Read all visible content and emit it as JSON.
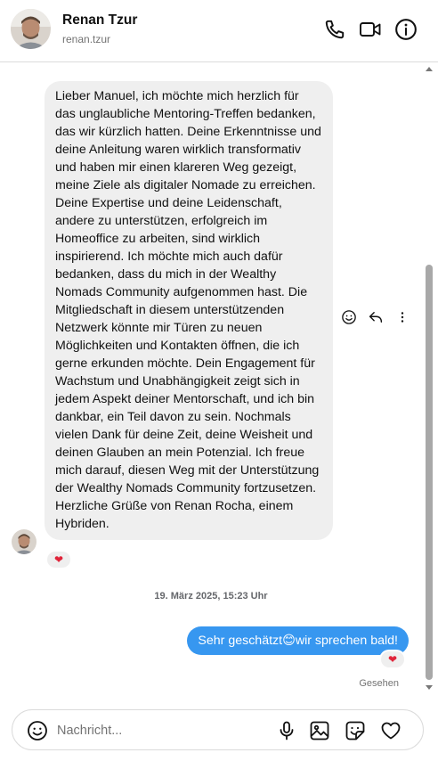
{
  "header": {
    "name": "Renan Tzur",
    "username": "renan.tzur",
    "icons": [
      "phone-icon",
      "video-call-icon",
      "info-icon"
    ]
  },
  "thread": {
    "incoming_message": {
      "text": "Lieber Manuel, ich möchte mich herzlich für das unglaubliche Mentoring-Treffen bedanken, das wir kürzlich hatten. Deine Erkenntnisse und deine Anleitung waren wirklich transformativ und haben mir einen klareren Weg gezeigt, meine Ziele als digitaler Nomade zu erreichen. Deine Expertise und deine Leidenschaft, andere zu unterstützen, erfolgreich im Homeoffice zu arbeiten, sind wirklich inspirierend. Ich möchte mich auch dafür bedanken, dass du mich in der Wealthy Nomads Community aufgenommen hast. Die Mitgliedschaft in diesem unterstützenden Netzwerk könnte mir Türen zu neuen Möglichkeiten und Kontakten öffnen, die ich gerne erkunden möchte. Dein Engagement für Wachstum und Unabhängigkeit zeigt sich in jedem Aspekt deiner Mentorschaft, und ich bin dankbar, ein Teil davon zu sein. Nochmals vielen Dank für deine Zeit, deine Weisheit und deinen Glauben an mein Potenzial. Ich freue mich darauf, diesen Weg mit der Unterstützung der Wealthy Nomads Community fortzusetzen. Herzliche Grüße von Renan Rocha, einem Hybriden.",
      "reaction": "❤"
    },
    "timestamp": "19. März 2025, 15:23 Uhr",
    "outgoing_message": {
      "text_before": "Sehr geschätzt",
      "emoji": "😊",
      "text_after": "wir sprechen bald!",
      "reaction": "❤"
    },
    "seen_label": "Gesehen"
  },
  "composer": {
    "placeholder": "Nachricht...",
    "icons": [
      "emoji-icon",
      "microphone-icon",
      "image-icon",
      "sticker-icon",
      "heart-icon"
    ]
  },
  "colors": {
    "outgoing_bubble": "#3797f0",
    "incoming_bubble": "#efefef",
    "reaction_heart": "#e0243a"
  }
}
